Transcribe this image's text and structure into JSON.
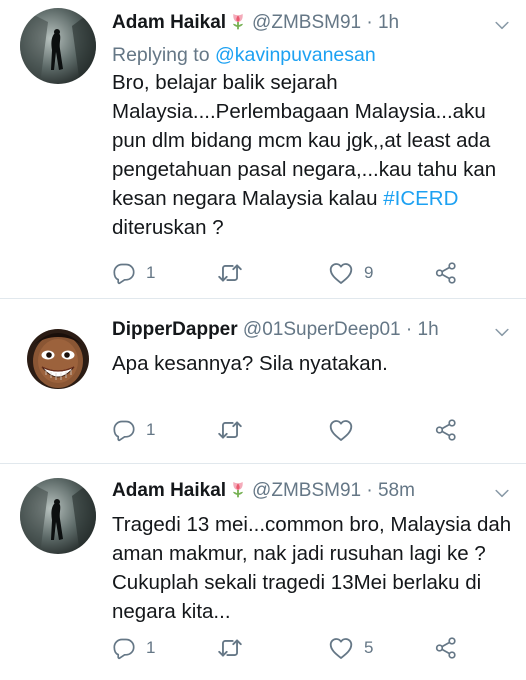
{
  "tweets": [
    {
      "name": "Adam Haikal",
      "handle": "@ZMBSM91",
      "dot": "·",
      "time": "1h",
      "replying_prefix": "Replying to",
      "replying_to": "@kavinpuvanesan",
      "text_before": "Bro, belajar balik sejarah Malaysia....Perlembagaan Malaysia...aku pun dlm bidang mcm kau jgk,,at least ada pengetahuan pasal negara,...kau tahu kan kesan negara Malaysia kalau ",
      "hashtag": "#ICERD",
      "text_after": " diteruskan ?",
      "replies": "1",
      "retweets": "",
      "likes": "9"
    },
    {
      "name": "DipperDapper",
      "handle": "@01SuperDeep01",
      "dot": "·",
      "time": "1h",
      "text": "Apa kesannya? Sila nyatakan.",
      "replies": "1",
      "retweets": "",
      "likes": ""
    },
    {
      "name": "Adam Haikal",
      "handle": "@ZMBSM91",
      "dot": "·",
      "time": "58m",
      "text": "Tragedi 13 mei...common bro, Malaysia dah aman makmur, nak jadi rusuhan lagi ke ? Cukuplah sekali tragedi 13Mei berlaku di negara kita...",
      "replies": "1",
      "retweets": "",
      "likes": "5"
    }
  ],
  "colors": {
    "text": "#14171a",
    "secondary": "#657786",
    "link": "#1da1f2",
    "divider": "#e1e8ed",
    "tulip": "#e0245e"
  },
  "icons": {
    "reply": "reply-icon",
    "retweet": "retweet-icon",
    "like": "heart-icon",
    "share": "share-icon",
    "caret": "chevron-down-icon",
    "emoji": "tulip-icon"
  }
}
